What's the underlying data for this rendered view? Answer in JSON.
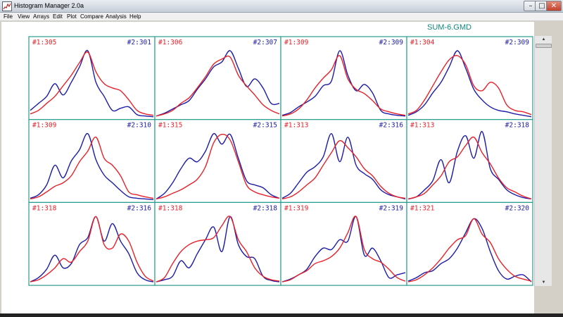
{
  "window": {
    "title": "Histogram Manager 2.0a",
    "min_glyph": "–",
    "max_glyph": "□",
    "close_glyph": "✕",
    "app_icon": "chart-app-icon"
  },
  "menu": [
    "File",
    "View",
    "Arrays",
    "Edit",
    "Plot",
    "Compare",
    "Analysis",
    "Help"
  ],
  "file_name": "SUM-6.GMD",
  "colors": {
    "frame": "#2a9d8f",
    "series1": "#e8212a",
    "series2": "#1c1ca8"
  },
  "scrollbar": {
    "up_glyph": "▲",
    "down_glyph": "▼"
  },
  "panels": [
    {
      "label1": "#1:305",
      "label2": "#2:301",
      "s1": [
        0.05,
        0.1,
        0.2,
        0.3,
        0.45,
        0.6,
        0.78,
        0.93,
        0.65,
        0.48,
        0.42,
        0.38,
        0.25,
        0.1,
        0.05,
        0.03
      ],
      "s2": [
        0.1,
        0.2,
        0.3,
        0.48,
        0.32,
        0.5,
        0.72,
        0.95,
        0.5,
        0.3,
        0.1,
        0.13,
        0.15,
        0.04,
        0.02,
        0.01
      ]
    },
    {
      "label1": "#1:306",
      "label2": "#2:307",
      "s1": [
        0.02,
        0.05,
        0.1,
        0.2,
        0.28,
        0.42,
        0.58,
        0.76,
        0.83,
        0.86,
        0.6,
        0.45,
        0.32,
        0.18,
        0.1,
        0.05
      ],
      "s2": [
        0.02,
        0.06,
        0.12,
        0.18,
        0.24,
        0.4,
        0.55,
        0.72,
        0.79,
        0.95,
        0.7,
        0.44,
        0.55,
        0.42,
        0.2,
        0.2
      ]
    },
    {
      "label1": "#1:309",
      "label2": "#2:309",
      "s1": [
        0.02,
        0.05,
        0.12,
        0.25,
        0.42,
        0.56,
        0.68,
        0.88,
        0.55,
        0.4,
        0.34,
        0.24,
        0.12,
        0.08,
        0.05,
        0.03
      ],
      "s2": [
        0.03,
        0.07,
        0.15,
        0.22,
        0.3,
        0.45,
        0.52,
        0.95,
        0.6,
        0.38,
        0.47,
        0.35,
        0.1,
        0.05,
        0.03,
        0.02
      ]
    },
    {
      "label1": "#1:304",
      "label2": "#2:309",
      "s1": [
        0.05,
        0.1,
        0.25,
        0.45,
        0.65,
        0.82,
        0.88,
        0.75,
        0.45,
        0.38,
        0.5,
        0.42,
        0.18,
        0.1,
        0.08,
        0.04
      ],
      "s2": [
        0.03,
        0.08,
        0.18,
        0.35,
        0.5,
        0.72,
        0.95,
        0.7,
        0.4,
        0.25,
        0.15,
        0.1,
        0.08,
        0.05,
        0.03,
        0.01
      ]
    },
    {
      "label1": "#1:309",
      "label2": "#2:310",
      "s1": [
        0.02,
        0.05,
        0.12,
        0.2,
        0.25,
        0.35,
        0.55,
        0.7,
        0.9,
        0.6,
        0.5,
        0.35,
        0.12,
        0.08,
        0.05,
        0.03
      ],
      "s2": [
        0.03,
        0.08,
        0.22,
        0.5,
        0.32,
        0.56,
        0.72,
        0.95,
        0.58,
        0.36,
        0.25,
        0.14,
        0.05,
        0.03,
        0.02,
        0.01
      ]
    },
    {
      "label1": "#1:315",
      "label2": "#2:315",
      "s1": [
        0.02,
        0.05,
        0.1,
        0.15,
        0.22,
        0.3,
        0.48,
        0.82,
        0.94,
        0.86,
        0.55,
        0.22,
        0.12,
        0.08,
        0.05,
        0.03
      ],
      "s2": [
        0.02,
        0.1,
        0.25,
        0.45,
        0.6,
        0.55,
        0.7,
        0.95,
        0.8,
        0.94,
        0.6,
        0.28,
        0.22,
        0.18,
        0.08,
        0.03
      ]
    },
    {
      "label1": "#1:313",
      "label2": "#2:316",
      "s1": [
        0.02,
        0.05,
        0.12,
        0.22,
        0.32,
        0.5,
        0.68,
        0.85,
        0.75,
        0.62,
        0.45,
        0.35,
        0.2,
        0.1,
        0.05,
        0.03
      ],
      "s2": [
        0.03,
        0.1,
        0.25,
        0.4,
        0.48,
        0.62,
        0.95,
        0.55,
        0.9,
        0.5,
        0.38,
        0.3,
        0.15,
        0.08,
        0.05,
        0.02
      ]
    },
    {
      "label1": "#1:313",
      "label2": "#2:318",
      "s1": [
        0.02,
        0.05,
        0.1,
        0.22,
        0.35,
        0.55,
        0.62,
        0.78,
        0.9,
        0.68,
        0.52,
        0.32,
        0.18,
        0.12,
        0.06,
        0.02
      ],
      "s2": [
        0.02,
        0.05,
        0.15,
        0.28,
        0.58,
        0.25,
        0.7,
        0.92,
        0.6,
        0.98,
        0.45,
        0.3,
        0.15,
        0.08,
        0.04,
        0.02
      ]
    },
    {
      "label1": "#1:318",
      "label2": "#2:316",
      "s1": [
        0.02,
        0.05,
        0.12,
        0.22,
        0.35,
        0.3,
        0.45,
        0.6,
        0.95,
        0.55,
        0.5,
        0.7,
        0.6,
        0.3,
        0.1,
        0.03
      ],
      "s2": [
        0.02,
        0.08,
        0.2,
        0.4,
        0.22,
        0.28,
        0.55,
        0.65,
        0.95,
        0.6,
        0.85,
        0.6,
        0.42,
        0.15,
        0.05,
        0.02
      ]
    },
    {
      "label1": "#1:318",
      "label2": "#2:318",
      "s1": [
        0.02,
        0.08,
        0.28,
        0.45,
        0.55,
        0.6,
        0.62,
        0.65,
        0.82,
        0.95,
        0.62,
        0.45,
        0.22,
        0.1,
        0.05,
        0.03
      ],
      "s2": [
        0.02,
        0.05,
        0.1,
        0.32,
        0.22,
        0.42,
        0.62,
        0.8,
        0.45,
        0.95,
        0.55,
        0.38,
        0.35,
        0.1,
        0.04,
        0.02
      ]
    },
    {
      "label1": "#1:319",
      "label2": "#2:319",
      "s1": [
        0.02,
        0.05,
        0.12,
        0.18,
        0.28,
        0.32,
        0.38,
        0.5,
        0.72,
        0.95,
        0.48,
        0.35,
        0.3,
        0.2,
        0.08,
        0.03
      ],
      "s2": [
        0.02,
        0.06,
        0.12,
        0.2,
        0.38,
        0.5,
        0.48,
        0.62,
        0.6,
        0.95,
        0.4,
        0.5,
        0.32,
        0.08,
        0.12,
        0.15
      ]
    },
    {
      "label1": "#1:321",
      "label2": "#2:320",
      "s1": [
        0.02,
        0.05,
        0.12,
        0.22,
        0.35,
        0.5,
        0.62,
        0.68,
        0.92,
        0.7,
        0.58,
        0.35,
        0.2,
        0.1,
        0.06,
        0.03
      ],
      "s2": [
        0.03,
        0.08,
        0.15,
        0.18,
        0.28,
        0.35,
        0.5,
        0.72,
        0.92,
        0.78,
        0.45,
        0.18,
        0.06,
        0.1,
        0.12,
        0.02
      ]
    }
  ]
}
